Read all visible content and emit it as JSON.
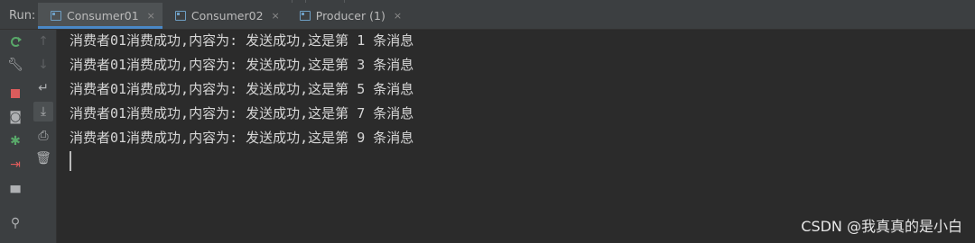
{
  "run_panel": {
    "label": "Run:",
    "tabs": [
      {
        "label": "Consumer01",
        "active": true
      },
      {
        "label": "Consumer02",
        "active": false
      },
      {
        "label": "Producer (1)",
        "active": false
      }
    ],
    "close_glyph": "×"
  },
  "toolbar_left": [
    {
      "name": "rerun-icon"
    },
    {
      "name": "wrench-icon"
    },
    {
      "name": "stop-icon"
    },
    {
      "name": "camera-icon"
    },
    {
      "name": "debug-icon"
    },
    {
      "name": "exit-icon"
    },
    {
      "name": "layout-icon"
    },
    {
      "name": "pin-icon"
    }
  ],
  "toolbar_right": [
    {
      "name": "up-arrow-icon"
    },
    {
      "name": "down-arrow-icon"
    },
    {
      "name": "soft-wrap-icon"
    },
    {
      "name": "scroll-to-end-icon"
    },
    {
      "name": "print-icon"
    },
    {
      "name": "trash-icon"
    }
  ],
  "console": {
    "lines": [
      "消费者01消费成功,内容为: 发送成功,这是第 1 条消息",
      "消费者01消费成功,内容为: 发送成功,这是第 3 条消息",
      "消费者01消费成功,内容为: 发送成功,这是第 5 条消息",
      "消费者01消费成功,内容为: 发送成功,这是第 7 条消息",
      "消费者01消费成功,内容为: 发送成功,这是第 9 条消息"
    ]
  },
  "watermark": "CSDN @我真真的是小白",
  "colors": {
    "background": "#2b2b2b",
    "panel": "#3c3f41",
    "tab_active_underline": "#4a88c7",
    "console_text": "#d6d6d6",
    "rerun_green": "#59a869",
    "stop_red": "#db5c5c"
  }
}
